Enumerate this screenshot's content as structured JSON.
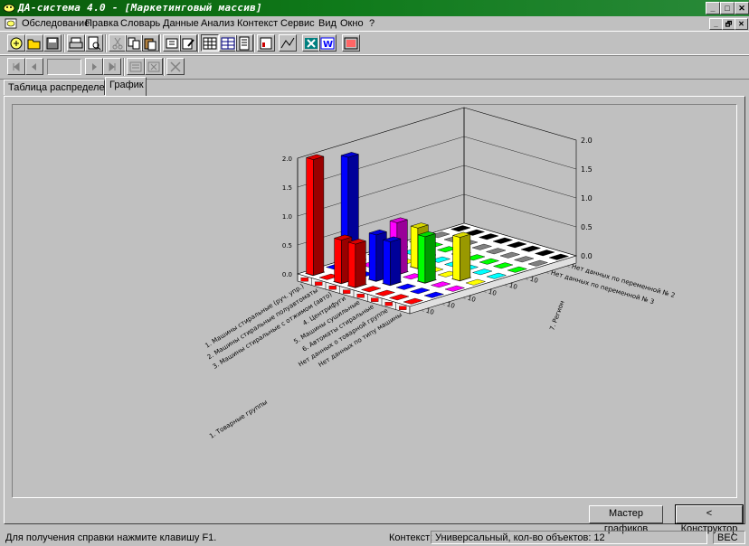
{
  "window": {
    "title": "ДА-система 4.0 - [Маркетинговый массив]",
    "minimize": "_",
    "maximize": "□",
    "close": "✕",
    "restore": "🗗"
  },
  "menu": {
    "items": [
      "Обследование",
      "Правка",
      "Словарь",
      "Данные",
      "Анализ",
      "Контекст",
      "Сервис",
      "Вид",
      "Окно",
      "?"
    ]
  },
  "tabs": [
    {
      "label": "Таблица распределений",
      "active": false
    },
    {
      "label": "График",
      "active": true
    }
  ],
  "buttons": {
    "chart_wizard": "Мастер графиков",
    "constructor": "< Конструктор"
  },
  "status": {
    "help": "Для получения справки нажмите клавишу F1.",
    "context_label": "Контекст:",
    "context_value": "Универсальный, кол-во объектов: 12",
    "indicator": "ВЕС"
  },
  "chart_data": {
    "type": "bar3d",
    "z_ticks_left": [
      "2.0",
      "1.5",
      "1.0",
      "0.5",
      "0.0"
    ],
    "z_ticks_right": [
      "2.0",
      "1.5",
      "1.0",
      "0.5",
      "0.0"
    ],
    "row_labels": [
      "1. Машины стиральные (руч. упр.)",
      "2. Машины стиральные полуавтоматы",
      "3. Машины стиральные с отжимом (авто)",
      "4. Центрифуги",
      "5. Машины сушильные",
      "6. Автоматы стиральные",
      "Нет данных о товарной группе",
      "Нет данных по типу машины"
    ],
    "row_axis_title": "1. Товарные группы",
    "series_labels": [
      "Нет данных по переменной № 2",
      "Нет данных по переменной № 3",
      "10",
      "10",
      "10",
      "10",
      "10",
      "10"
    ],
    "series_axis_title": "7. Регион",
    "bars": [
      {
        "row": 0,
        "col": 0,
        "value": 2.0,
        "color": "#ff0000"
      },
      {
        "row": 1,
        "col": 1,
        "value": 2.0,
        "color": "#0000ff"
      },
      {
        "row": 3,
        "col": 1,
        "value": 0.8,
        "color": "#0000ff"
      },
      {
        "row": 3,
        "col": 2,
        "value": 0.9,
        "color": "#ff00ff"
      },
      {
        "row": 3,
        "col": 3,
        "value": 0.7,
        "color": "#ffff00"
      },
      {
        "row": 4,
        "col": 1,
        "value": 0.75,
        "color": "#0000ff"
      },
      {
        "row": 5,
        "col": 2,
        "value": 0.8,
        "color": "#00ff00"
      },
      {
        "row": 6,
        "col": 3,
        "value": 0.75,
        "color": "#ffff00"
      },
      {
        "row": 2,
        "col": 0,
        "value": 0.75,
        "color": "#ff0000"
      },
      {
        "row": 3,
        "col": 0,
        "value": 0.75,
        "color": "#ff0000"
      }
    ],
    "floor_colors": [
      "#ff0000",
      "#0000ff",
      "#ff00ff",
      "#ffff00",
      "#00ffff",
      "#00ff00",
      "#808080",
      "#000000"
    ]
  }
}
